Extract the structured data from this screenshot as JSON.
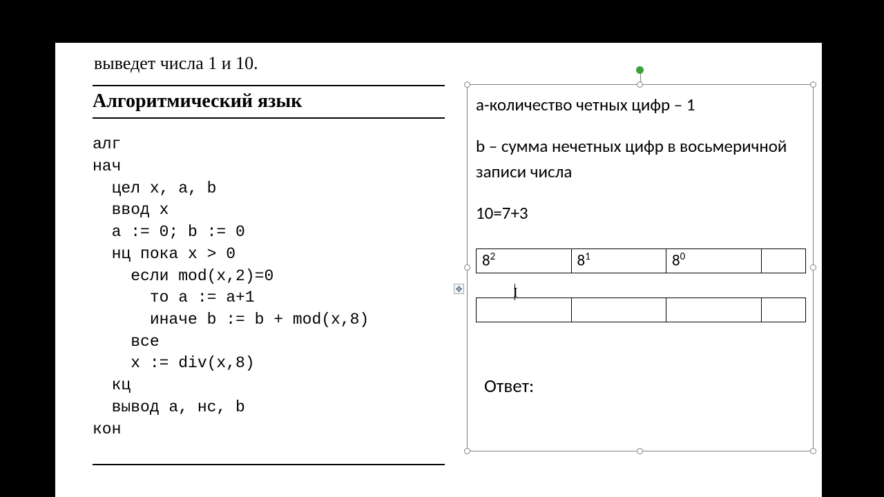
{
  "left": {
    "truncated_line": "выведет числа 1 и 10.",
    "section_title": "Алгоритмический язык",
    "code": "алг\nнач\n  цел x, a, b\n  ввод x\n  a := 0; b := 0\n  нц пока x > 0\n    если mod(x,2)=0\n      то a := a+1\n      иначе b := b + mod(x,8)\n    все\n    x := div(x,8)\n  кц\n  вывод a, нс, b\nкон"
  },
  "right": {
    "para1": "a-количество четных цифр – 1",
    "para2": "b – сумма нечетных цифр в восьмеричной записи числа",
    "para3": "10=7+3",
    "table": {
      "headers": [
        "8²",
        "8¹",
        "8⁰",
        ""
      ],
      "row2": [
        "",
        "",
        "",
        ""
      ]
    },
    "answer_label": "Ответ:"
  }
}
